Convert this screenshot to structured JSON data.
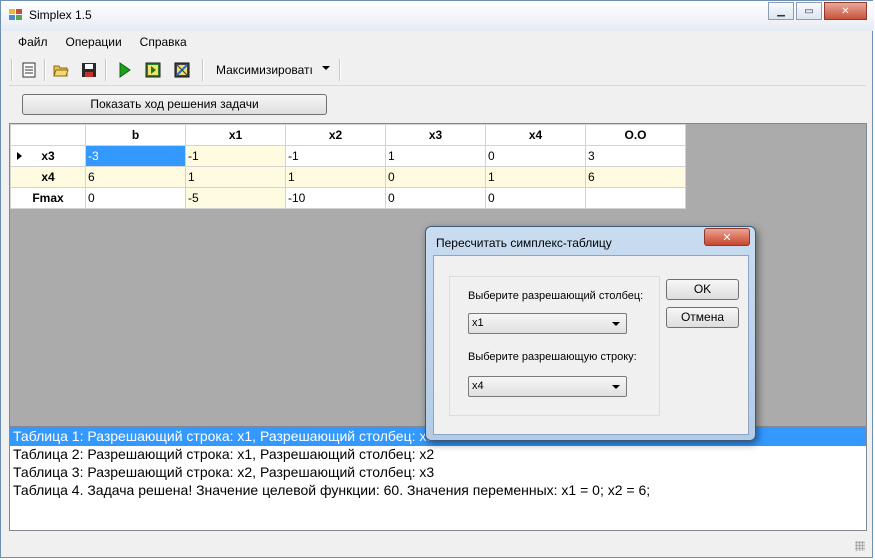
{
  "window": {
    "title": "Simplex 1.5",
    "min_glyph": "▁",
    "max_glyph": "▭",
    "close_glyph": "✕"
  },
  "menu": [
    "Файл",
    "Операции",
    "Справка"
  ],
  "toolbar": {
    "buttons": [
      {
        "name": "new-table-icon"
      },
      {
        "name": "open-folder-icon"
      },
      {
        "name": "save-icon"
      },
      {
        "name": "run-play-icon"
      },
      {
        "name": "step-icon"
      },
      {
        "name": "recalc-icon"
      }
    ],
    "mode_select": "Максимизироватı"
  },
  "show_solution_button": "Показать ход решения задачи",
  "grid": {
    "columns": [
      "b",
      "x1",
      "x2",
      "x3",
      "x4",
      "O.O"
    ],
    "rows": [
      {
        "header": "x3",
        "cells": [
          "-3",
          "-1",
          "-1",
          "1",
          "0",
          "3"
        ]
      },
      {
        "header": "x4",
        "cells": [
          "6",
          "1",
          "1",
          "0",
          "1",
          "6"
        ]
      },
      {
        "header": "Fmax",
        "cells": [
          "0",
          "-5",
          "-10",
          "0",
          "0",
          ""
        ]
      }
    ]
  },
  "log": [
    "Таблица 1: Разрешающий строка: x1, Разрешающий столбец: x3",
    "Таблица 2: Разрешающий строка: x1, Разрешающий столбец: x2",
    "Таблица 3: Разрешающий строка: x2, Разрешающий столбец: x3",
    "Таблица 4. Задача решена! Значение целевой функции: 60. Значения переменных: x1 = 0; x2 = 6;"
  ],
  "dialog": {
    "title": "Пересчитать симплекс-таблицу",
    "close_glyph": "✕",
    "column_label": "Выберите разрешающий столбец:",
    "column_value": "x1",
    "row_label": "Выберите разрешающую строку:",
    "row_value": "x4",
    "ok_label": "OK",
    "cancel_label": "Отмена"
  },
  "colors": {
    "selection": "#3399ff",
    "highlight_cell": "#fffbe0",
    "grid_bg": "#ababab"
  }
}
